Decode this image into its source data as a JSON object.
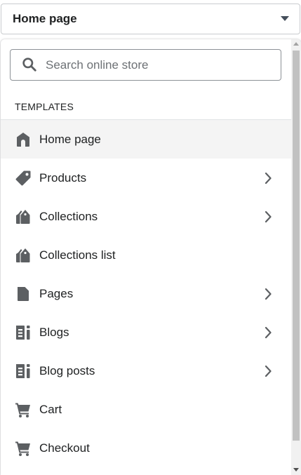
{
  "selector": {
    "label": "Home page",
    "caret_icon": "caret-down-icon"
  },
  "search": {
    "placeholder": "Search online store",
    "value": "",
    "icon": "search-icon"
  },
  "templates": {
    "title": "TEMPLATES",
    "items": [
      {
        "label": "Home page",
        "icon": "home-icon",
        "active": true,
        "has_chevron": false
      },
      {
        "label": "Products",
        "icon": "tag-icon",
        "active": false,
        "has_chevron": true
      },
      {
        "label": "Collections",
        "icon": "collections-icon",
        "active": false,
        "has_chevron": true
      },
      {
        "label": "Collections list",
        "icon": "collections-icon",
        "active": false,
        "has_chevron": false
      },
      {
        "label": "Pages",
        "icon": "page-icon",
        "active": false,
        "has_chevron": true
      },
      {
        "label": "Blogs",
        "icon": "blog-icon",
        "active": false,
        "has_chevron": true
      },
      {
        "label": "Blog posts",
        "icon": "blog-icon",
        "active": false,
        "has_chevron": true
      },
      {
        "label": "Cart",
        "icon": "cart-icon",
        "active": false,
        "has_chevron": false
      },
      {
        "label": "Checkout",
        "icon": "cart-icon",
        "active": false,
        "has_chevron": false
      }
    ]
  },
  "colors": {
    "icon": "#5c5f62",
    "active_row": "#f4f4f4",
    "text": "#202223"
  }
}
